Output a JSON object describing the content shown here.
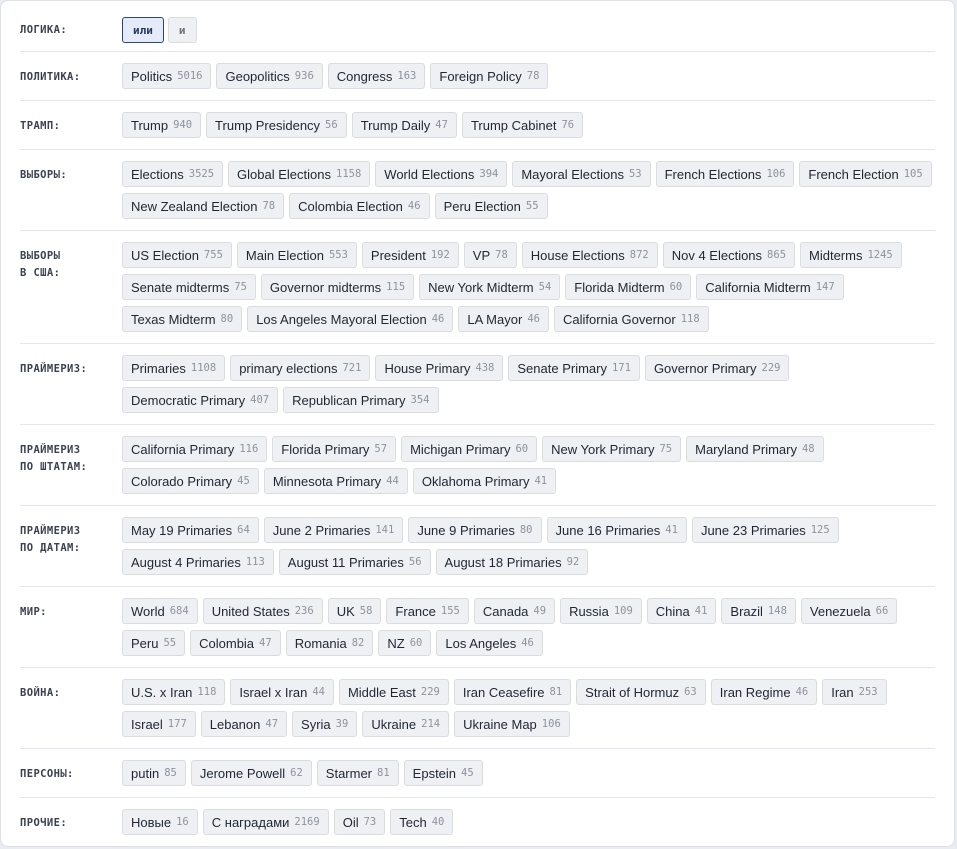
{
  "colors": {
    "background": "#ffffff",
    "chip_background": "#eef0f3",
    "chip_border": "#d9dce2",
    "active_border": "#2e4480",
    "count_text": "#8c939e",
    "label_text": "#3a4250"
  },
  "logic": {
    "label": "ЛОГИКА:",
    "options": [
      "или",
      "и"
    ],
    "selected": "или"
  },
  "categories": [
    {
      "label": "ПОЛИТИКА:",
      "chips": [
        {
          "name": "Politics",
          "count": "5016"
        },
        {
          "name": "Geopolitics",
          "count": "936"
        },
        {
          "name": "Congress",
          "count": "163"
        },
        {
          "name": "Foreign Policy",
          "count": "78"
        }
      ]
    },
    {
      "label": "ТРАМП:",
      "chips": [
        {
          "name": "Trump",
          "count": "940"
        },
        {
          "name": "Trump Presidency",
          "count": "56"
        },
        {
          "name": "Trump Daily",
          "count": "47"
        },
        {
          "name": "Trump Cabinet",
          "count": "76"
        }
      ]
    },
    {
      "label": "ВЫБОРЫ:",
      "chips": [
        {
          "name": "Elections",
          "count": "3525"
        },
        {
          "name": "Global Elections",
          "count": "1158"
        },
        {
          "name": "World Elections",
          "count": "394"
        },
        {
          "name": "Mayoral Elections",
          "count": "53"
        },
        {
          "name": "French Elections",
          "count": "106"
        },
        {
          "name": "French Election",
          "count": "105"
        },
        {
          "name": "New Zealand Election",
          "count": "78"
        },
        {
          "name": "Colombia Election",
          "count": "46"
        },
        {
          "name": "Peru Election",
          "count": "55"
        }
      ]
    },
    {
      "label": "ВЫБОРЫ\nВ США:",
      "chips": [
        {
          "name": "US Election",
          "count": "755"
        },
        {
          "name": "Main Election",
          "count": "553"
        },
        {
          "name": "President",
          "count": "192"
        },
        {
          "name": "VP",
          "count": "78"
        },
        {
          "name": "House Elections",
          "count": "872"
        },
        {
          "name": "Nov 4 Elections",
          "count": "865"
        },
        {
          "name": "Midterms",
          "count": "1245"
        },
        {
          "name": "Senate midterms",
          "count": "75"
        },
        {
          "name": "Governor midterms",
          "count": "115"
        },
        {
          "name": "New York Midterm",
          "count": "54"
        },
        {
          "name": "Florida Midterm",
          "count": "60"
        },
        {
          "name": "California Midterm",
          "count": "147"
        },
        {
          "name": "Texas Midterm",
          "count": "80"
        },
        {
          "name": "Los Angeles Mayoral Election",
          "count": "46"
        },
        {
          "name": "LA Mayor",
          "count": "46"
        },
        {
          "name": "California Governor",
          "count": "118"
        }
      ]
    },
    {
      "label": "ПРАЙМЕРИЗ:",
      "chips": [
        {
          "name": "Primaries",
          "count": "1108"
        },
        {
          "name": "primary elections",
          "count": "721"
        },
        {
          "name": "House Primary",
          "count": "438"
        },
        {
          "name": "Senate Primary",
          "count": "171"
        },
        {
          "name": "Governor Primary",
          "count": "229"
        },
        {
          "name": "Democratic Primary",
          "count": "407"
        },
        {
          "name": "Republican Primary",
          "count": "354"
        }
      ]
    },
    {
      "label": "ПРАЙМЕРИЗ\nПО ШТАТАМ:",
      "chips": [
        {
          "name": "California Primary",
          "count": "116"
        },
        {
          "name": "Florida Primary",
          "count": "57"
        },
        {
          "name": "Michigan Primary",
          "count": "60"
        },
        {
          "name": "New York Primary",
          "count": "75"
        },
        {
          "name": "Maryland Primary",
          "count": "48"
        },
        {
          "name": "Colorado Primary",
          "count": "45"
        },
        {
          "name": "Minnesota Primary",
          "count": "44"
        },
        {
          "name": "Oklahoma Primary",
          "count": "41"
        }
      ]
    },
    {
      "label": "ПРАЙМЕРИЗ\nПО ДАТАМ:",
      "chips": [
        {
          "name": "May 19 Primaries",
          "count": "64"
        },
        {
          "name": "June 2 Primaries",
          "count": "141"
        },
        {
          "name": "June 9 Primaries",
          "count": "80"
        },
        {
          "name": "June 16 Primaries",
          "count": "41"
        },
        {
          "name": "June 23 Primaries",
          "count": "125"
        },
        {
          "name": "August 4 Primaries",
          "count": "113"
        },
        {
          "name": "August 11 Primaries",
          "count": "56"
        },
        {
          "name": "August 18 Primaries",
          "count": "92"
        }
      ]
    },
    {
      "label": "МИР:",
      "chips": [
        {
          "name": "World",
          "count": "684"
        },
        {
          "name": "United States",
          "count": "236"
        },
        {
          "name": "UK",
          "count": "58"
        },
        {
          "name": "France",
          "count": "155"
        },
        {
          "name": "Canada",
          "count": "49"
        },
        {
          "name": "Russia",
          "count": "109"
        },
        {
          "name": "China",
          "count": "41"
        },
        {
          "name": "Brazil",
          "count": "148"
        },
        {
          "name": "Venezuela",
          "count": "66"
        },
        {
          "name": "Peru",
          "count": "55"
        },
        {
          "name": "Colombia",
          "count": "47"
        },
        {
          "name": "Romania",
          "count": "82"
        },
        {
          "name": "NZ",
          "count": "60"
        },
        {
          "name": "Los Angeles",
          "count": "46"
        }
      ]
    },
    {
      "label": "ВОЙНА:",
      "chips": [
        {
          "name": "U.S. x Iran",
          "count": "118"
        },
        {
          "name": "Israel x Iran",
          "count": "44"
        },
        {
          "name": "Middle East",
          "count": "229"
        },
        {
          "name": "Iran Ceasefire",
          "count": "81"
        },
        {
          "name": "Strait of Hormuz",
          "count": "63"
        },
        {
          "name": "Iran Regime",
          "count": "46"
        },
        {
          "name": "Iran",
          "count": "253"
        },
        {
          "name": "Israel",
          "count": "177"
        },
        {
          "name": "Lebanon",
          "count": "47"
        },
        {
          "name": "Syria",
          "count": "39"
        },
        {
          "name": "Ukraine",
          "count": "214"
        },
        {
          "name": "Ukraine Map",
          "count": "106"
        }
      ]
    },
    {
      "label": "ПЕРСОНЫ:",
      "chips": [
        {
          "name": "putin",
          "count": "85"
        },
        {
          "name": "Jerome Powell",
          "count": "62"
        },
        {
          "name": "Starmer",
          "count": "81"
        },
        {
          "name": "Epstein",
          "count": "45"
        }
      ]
    },
    {
      "label": "ПРОЧИЕ:",
      "chips": [
        {
          "name": "Новые",
          "count": "16"
        },
        {
          "name": "С наградами",
          "count": "2169"
        },
        {
          "name": "Oil",
          "count": "73"
        },
        {
          "name": "Tech",
          "count": "40"
        }
      ]
    }
  ]
}
